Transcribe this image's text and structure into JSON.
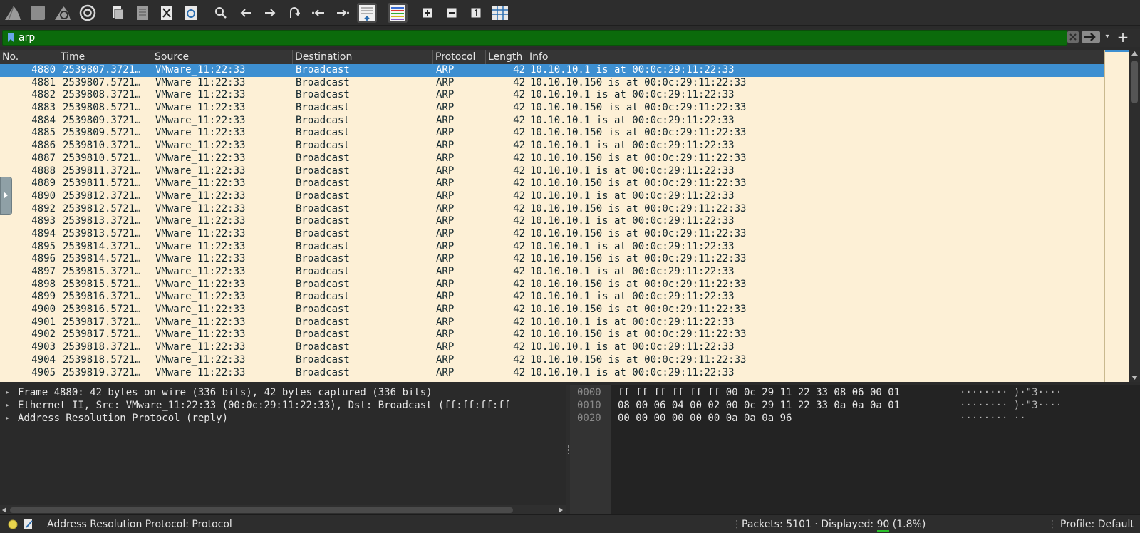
{
  "toolbar": {
    "icons": [
      "shark-fin-start-icon",
      "stop-capture-icon",
      "restart-capture-icon",
      "capture-options-icon",
      "open-file-icon",
      "save-file-icon",
      "close-file-icon",
      "reload-file-icon",
      "find-packet-icon",
      "go-back-icon",
      "go-forward-icon",
      "go-to-packet-icon",
      "first-packet-icon",
      "last-packet-icon",
      "autoscroll-icon",
      "colorize-icon",
      "zoom-in-icon",
      "zoom-out-icon",
      "normal-size-icon",
      "resize-columns-icon"
    ]
  },
  "filter": {
    "value": "arp"
  },
  "packet_list": {
    "columns": [
      "No.",
      "Time",
      "Source",
      "Destination",
      "Protocol",
      "Length",
      "Info"
    ],
    "rows": [
      {
        "no": "4880",
        "time": "2539807.3721…",
        "source": "VMware_11:22:33",
        "destination": "Broadcast",
        "protocol": "ARP",
        "length": "42",
        "info": "10.10.10.1 is at 00:0c:29:11:22:33"
      },
      {
        "no": "4881",
        "time": "2539807.5721…",
        "source": "VMware_11:22:33",
        "destination": "Broadcast",
        "protocol": "ARP",
        "length": "42",
        "info": "10.10.10.150 is at 00:0c:29:11:22:33"
      },
      {
        "no": "4882",
        "time": "2539808.3721…",
        "source": "VMware_11:22:33",
        "destination": "Broadcast",
        "protocol": "ARP",
        "length": "42",
        "info": "10.10.10.1 is at 00:0c:29:11:22:33"
      },
      {
        "no": "4883",
        "time": "2539808.5721…",
        "source": "VMware_11:22:33",
        "destination": "Broadcast",
        "protocol": "ARP",
        "length": "42",
        "info": "10.10.10.150 is at 00:0c:29:11:22:33"
      },
      {
        "no": "4884",
        "time": "2539809.3721…",
        "source": "VMware_11:22:33",
        "destination": "Broadcast",
        "protocol": "ARP",
        "length": "42",
        "info": "10.10.10.1 is at 00:0c:29:11:22:33"
      },
      {
        "no": "4885",
        "time": "2539809.5721…",
        "source": "VMware_11:22:33",
        "destination": "Broadcast",
        "protocol": "ARP",
        "length": "42",
        "info": "10.10.10.150 is at 00:0c:29:11:22:33"
      },
      {
        "no": "4886",
        "time": "2539810.3721…",
        "source": "VMware_11:22:33",
        "destination": "Broadcast",
        "protocol": "ARP",
        "length": "42",
        "info": "10.10.10.1 is at 00:0c:29:11:22:33"
      },
      {
        "no": "4887",
        "time": "2539810.5721…",
        "source": "VMware_11:22:33",
        "destination": "Broadcast",
        "protocol": "ARP",
        "length": "42",
        "info": "10.10.10.150 is at 00:0c:29:11:22:33"
      },
      {
        "no": "4888",
        "time": "2539811.3721…",
        "source": "VMware_11:22:33",
        "destination": "Broadcast",
        "protocol": "ARP",
        "length": "42",
        "info": "10.10.10.1 is at 00:0c:29:11:22:33"
      },
      {
        "no": "4889",
        "time": "2539811.5721…",
        "source": "VMware_11:22:33",
        "destination": "Broadcast",
        "protocol": "ARP",
        "length": "42",
        "info": "10.10.10.150 is at 00:0c:29:11:22:33"
      },
      {
        "no": "4890",
        "time": "2539812.3721…",
        "source": "VMware_11:22:33",
        "destination": "Broadcast",
        "protocol": "ARP",
        "length": "42",
        "info": "10.10.10.1 is at 00:0c:29:11:22:33"
      },
      {
        "no": "4892",
        "time": "2539812.5721…",
        "source": "VMware_11:22:33",
        "destination": "Broadcast",
        "protocol": "ARP",
        "length": "42",
        "info": "10.10.10.150 is at 00:0c:29:11:22:33"
      },
      {
        "no": "4893",
        "time": "2539813.3721…",
        "source": "VMware_11:22:33",
        "destination": "Broadcast",
        "protocol": "ARP",
        "length": "42",
        "info": "10.10.10.1 is at 00:0c:29:11:22:33"
      },
      {
        "no": "4894",
        "time": "2539813.5721…",
        "source": "VMware_11:22:33",
        "destination": "Broadcast",
        "protocol": "ARP",
        "length": "42",
        "info": "10.10.10.150 is at 00:0c:29:11:22:33"
      },
      {
        "no": "4895",
        "time": "2539814.3721…",
        "source": "VMware_11:22:33",
        "destination": "Broadcast",
        "protocol": "ARP",
        "length": "42",
        "info": "10.10.10.1 is at 00:0c:29:11:22:33"
      },
      {
        "no": "4896",
        "time": "2539814.5721…",
        "source": "VMware_11:22:33",
        "destination": "Broadcast",
        "protocol": "ARP",
        "length": "42",
        "info": "10.10.10.150 is at 00:0c:29:11:22:33"
      },
      {
        "no": "4897",
        "time": "2539815.3721…",
        "source": "VMware_11:22:33",
        "destination": "Broadcast",
        "protocol": "ARP",
        "length": "42",
        "info": "10.10.10.1 is at 00:0c:29:11:22:33"
      },
      {
        "no": "4898",
        "time": "2539815.5721…",
        "source": "VMware_11:22:33",
        "destination": "Broadcast",
        "protocol": "ARP",
        "length": "42",
        "info": "10.10.10.150 is at 00:0c:29:11:22:33"
      },
      {
        "no": "4899",
        "time": "2539816.3721…",
        "source": "VMware_11:22:33",
        "destination": "Broadcast",
        "protocol": "ARP",
        "length": "42",
        "info": "10.10.10.1 is at 00:0c:29:11:22:33"
      },
      {
        "no": "4900",
        "time": "2539816.5721…",
        "source": "VMware_11:22:33",
        "destination": "Broadcast",
        "protocol": "ARP",
        "length": "42",
        "info": "10.10.10.150 is at 00:0c:29:11:22:33"
      },
      {
        "no": "4901",
        "time": "2539817.3721…",
        "source": "VMware_11:22:33",
        "destination": "Broadcast",
        "protocol": "ARP",
        "length": "42",
        "info": "10.10.10.1 is at 00:0c:29:11:22:33"
      },
      {
        "no": "4902",
        "time": "2539817.5721…",
        "source": "VMware_11:22:33",
        "destination": "Broadcast",
        "protocol": "ARP",
        "length": "42",
        "info": "10.10.10.150 is at 00:0c:29:11:22:33"
      },
      {
        "no": "4903",
        "time": "2539818.3721…",
        "source": "VMware_11:22:33",
        "destination": "Broadcast",
        "protocol": "ARP",
        "length": "42",
        "info": "10.10.10.1 is at 00:0c:29:11:22:33"
      },
      {
        "no": "4904",
        "time": "2539818.5721…",
        "source": "VMware_11:22:33",
        "destination": "Broadcast",
        "protocol": "ARP",
        "length": "42",
        "info": "10.10.10.150 is at 00:0c:29:11:22:33"
      },
      {
        "no": "4905",
        "time": "2539819.3721…",
        "source": "VMware_11:22:33",
        "destination": "Broadcast",
        "protocol": "ARP",
        "length": "42",
        "info": "10.10.10.1 is at 00:0c:29:11:22:33"
      }
    ],
    "selected_index": 0
  },
  "details": {
    "items": [
      "Frame 4880: 42 bytes on wire (336 bits), 42 bytes captured (336 bits)",
      "Ethernet II, Src: VMware_11:22:33 (00:0c:29:11:22:33), Dst: Broadcast (ff:ff:ff:ff",
      "Address Resolution Protocol (reply)"
    ]
  },
  "bytes": {
    "rows": [
      {
        "offset": "0000",
        "hex": "ff ff ff ff ff ff 00 0c  29 11 22 33 08 06 00 01",
        "ascii": "········ )·\"3····"
      },
      {
        "offset": "0010",
        "hex": "08 00 06 04 00 02 00 0c  29 11 22 33 0a 0a 0a 01",
        "ascii": "········ )·\"3····"
      },
      {
        "offset": "0020",
        "hex": "00 00 00 00 00 00 0a 0a  0a 96",
        "ascii": "········ ··"
      }
    ]
  },
  "status": {
    "field_info": "Address Resolution Protocol: Protocol",
    "packets_label": "Packets: 5101 · Displayed: ",
    "displayed_count": "90",
    "displayed_pct": " (1.8%)",
    "profile": "Profile: Default"
  },
  "colors": {
    "filter_valid": "#0b6b0b",
    "row_background": "#fdf0d6",
    "selected_row": "#3d8fd1",
    "status_ready": "#e8d44d"
  }
}
